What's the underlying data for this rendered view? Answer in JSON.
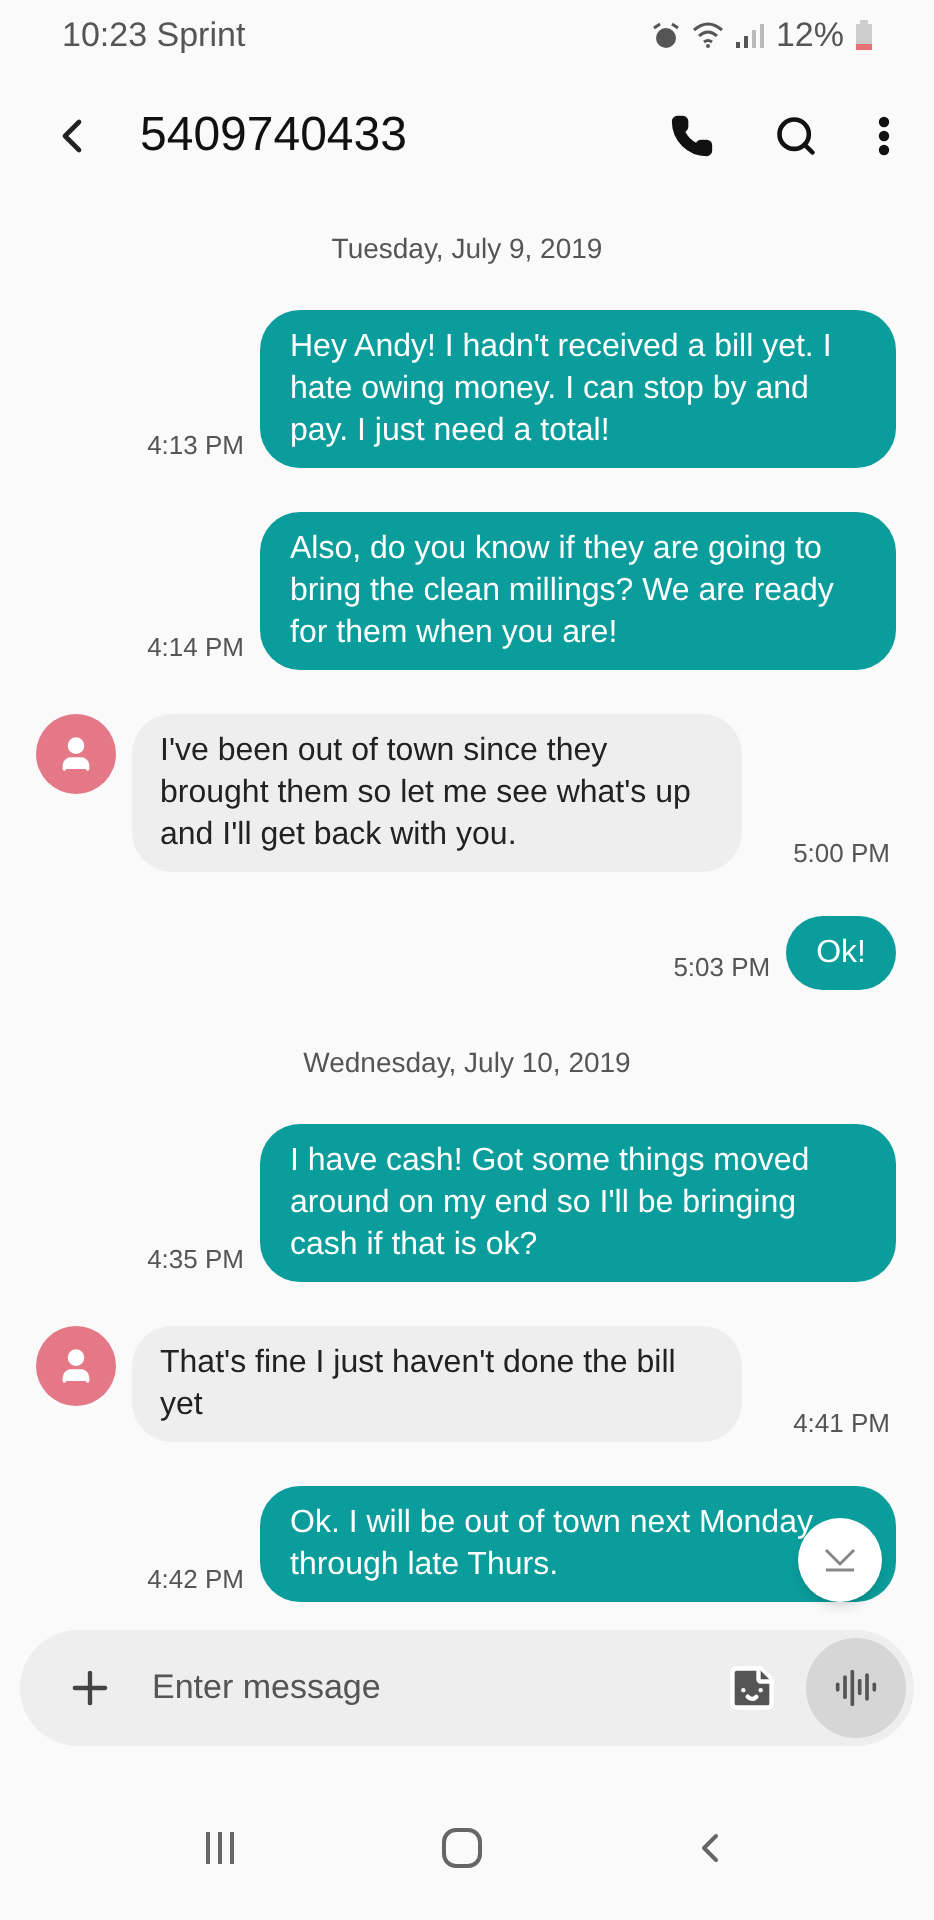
{
  "status_bar": {
    "time_carrier": "10:23 Sprint",
    "battery": "12%"
  },
  "header": {
    "title": "5409740433"
  },
  "messages": [
    {
      "kind": "date",
      "text": "Tuesday, July 9, 2019"
    },
    {
      "kind": "sent",
      "text": "Hey Andy! I hadn't received a bill yet. I hate owing money. I can stop by and pay. I just need a total!",
      "time": "4:13 PM"
    },
    {
      "kind": "sent",
      "text": "Also, do you know if they are going to bring the clean millings? We are ready for them when you are!",
      "time": "4:14 PM"
    },
    {
      "kind": "received",
      "text": "I've been out of town since they brought them so let me see what's up and I'll get back with you.",
      "time": "5:00 PM"
    },
    {
      "kind": "sent",
      "text": "Ok!",
      "time": "5:03 PM"
    },
    {
      "kind": "date",
      "text": "Wednesday, July 10, 2019"
    },
    {
      "kind": "sent",
      "text": "I have cash! Got some things moved around on my end so I'll be bringing cash if that is ok?",
      "time": "4:35 PM"
    },
    {
      "kind": "received",
      "text": "That's fine I just haven't done the bill yet",
      "time": "4:41 PM"
    },
    {
      "kind": "sent",
      "text": "Ok. I will be out of town next Monday through late Thurs.",
      "time": "4:42 PM"
    }
  ],
  "composer": {
    "placeholder": "Enter message"
  }
}
